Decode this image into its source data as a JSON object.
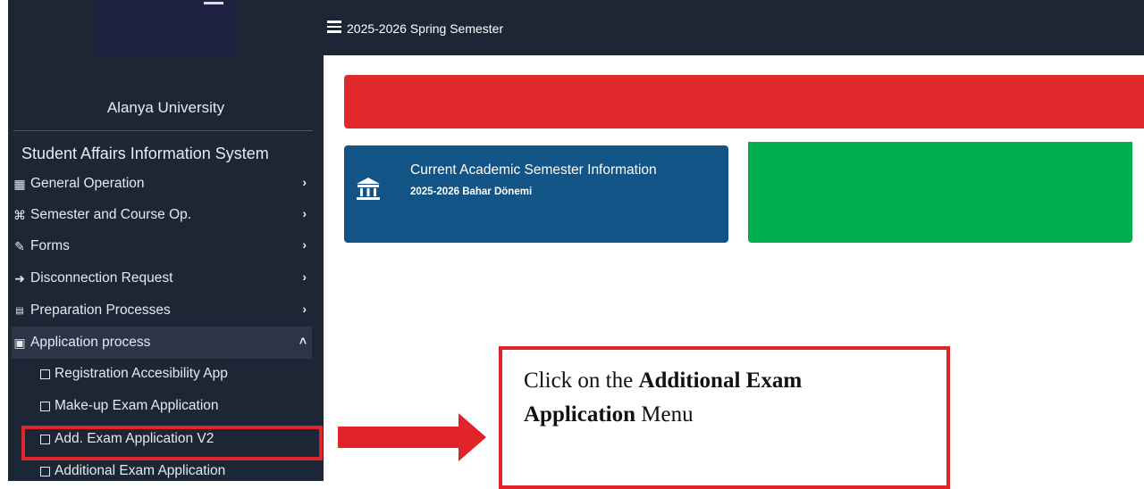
{
  "sidebar": {
    "university": "Alanya University",
    "system_title": "Student Affairs Information System",
    "menu": [
      {
        "label": "General Operation",
        "icon": "table-icon"
      },
      {
        "label": "Semester and Course Op.",
        "icon": "network-icon"
      },
      {
        "label": "Forms",
        "icon": "edit-form-icon"
      },
      {
        "label": "Disconnection Request",
        "icon": "sign-out-icon"
      },
      {
        "label": "Preparation Processes",
        "icon": "ab-icon"
      },
      {
        "label": "Application process",
        "icon": "id-card-icon"
      }
    ],
    "submenu": [
      {
        "label": "Registration Accesibility App"
      },
      {
        "label": "Make-up Exam Application"
      },
      {
        "label": "Add. Exam Application V2"
      },
      {
        "label": "Additional Exam Application"
      }
    ]
  },
  "topbar": {
    "title": "2025-2026 Spring Semester"
  },
  "info_card": {
    "title": "Current Academic Semester Information",
    "subtitle": "2025-2026 Bahar Dönemi"
  },
  "callout": {
    "prefix": "Click on the ",
    "bold": "Additional Exam Application",
    "suffix": " Menu"
  },
  "colors": {
    "sidebar_bg": "#1d2634",
    "banner_red": "#e1282b",
    "card_blue": "#135487",
    "card_green": "#00ad4f",
    "highlight_red": "#e0242a"
  }
}
